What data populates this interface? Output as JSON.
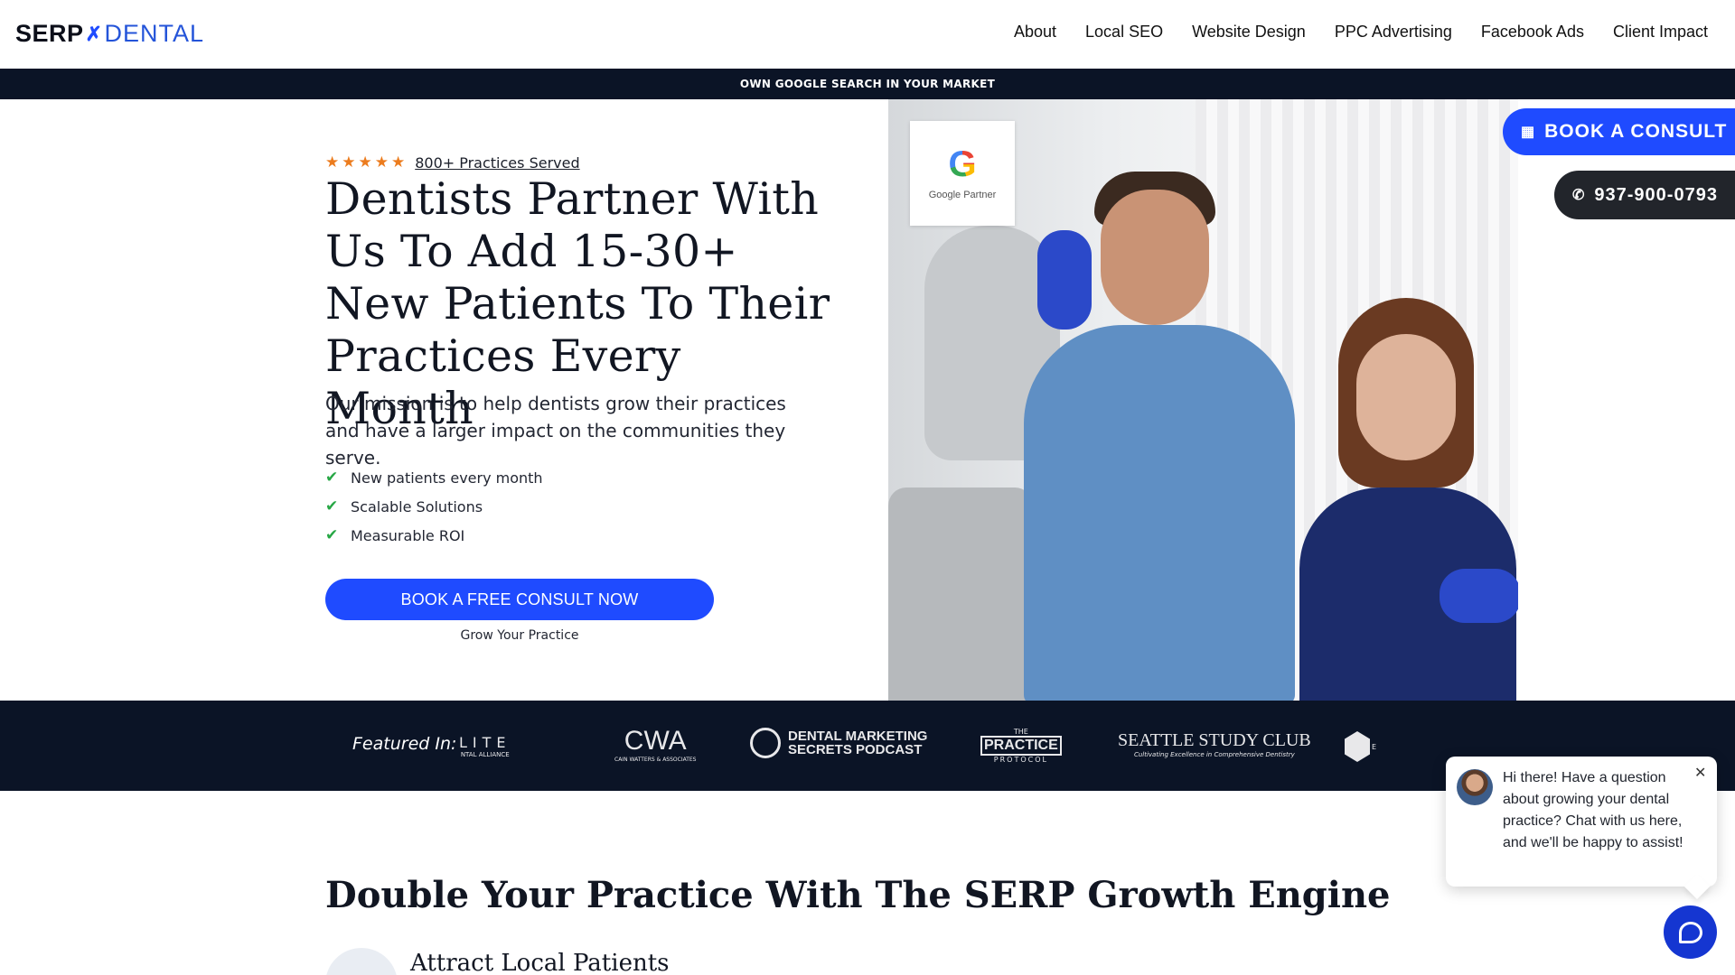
{
  "header": {
    "logo": {
      "serp": "SERP",
      "x_mark": "✗",
      "dental": "DENTAL"
    },
    "nav": [
      "About",
      "Local SEO",
      "Website Design",
      "PPC Advertising",
      "Facebook Ads",
      "Client Impact"
    ]
  },
  "announcement": "OWN GOOGLE SEARCH IN YOUR MARKET",
  "hero": {
    "stars": "★★★★★",
    "rating_text": "800+ Practices Served",
    "title": "Dentists Partner With Us To Add 15-30+ New Patients To Their Practices Every Month",
    "subtitle": "Our mission is to help dentists grow their practices and have a larger impact on the communities they serve.",
    "checks": [
      "New patients every month",
      "Scalable Solutions",
      "Measurable ROI"
    ],
    "cta": "BOOK A FREE CONSULT NOW",
    "cta_sub": "Grow Your Practice",
    "badge_letter": "G",
    "badge_text": "Google Partner"
  },
  "floating": {
    "consult_label": "BOOK A CONSULT",
    "phone": "937-900-0793"
  },
  "featured": {
    "label": "Featured In:",
    "logos": {
      "lite": {
        "big": "LITE",
        "small": "NTAL ALLIANCE"
      },
      "cwa": {
        "big": "CWA",
        "small": "CAIN WATTERS & ASSOCIATES"
      },
      "dms": {
        "line1": "DENTAL MARKETING",
        "line2": "SECRETS PODCAST"
      },
      "pp": {
        "a": "THE",
        "b": "PRACTICE",
        "c": "PROTOCOL"
      },
      "ssc": {
        "big": "SEATTLE STUDY CLUB",
        "small": "Cultivating Excellence in Comprehensive Dentistry"
      },
      "e": {
        "small": "E"
      }
    }
  },
  "growth": {
    "title": "Double Your Practice With The SERP Growth Engine",
    "feature1": "Attract Local Patients"
  },
  "chat": {
    "message": "Hi there! Have a question about growing your dental practice? Chat with us here, and we'll be happy to assist!",
    "close": "✕"
  },
  "colors": {
    "brand_blue": "#1f4bff",
    "navy": "#0b1426",
    "star_orange": "#ec7c1e",
    "check_green": "#27a745"
  },
  "icons": [
    "calendar-icon",
    "phone-icon",
    "check-icon",
    "star-icon",
    "close-icon",
    "chat-icon"
  ]
}
